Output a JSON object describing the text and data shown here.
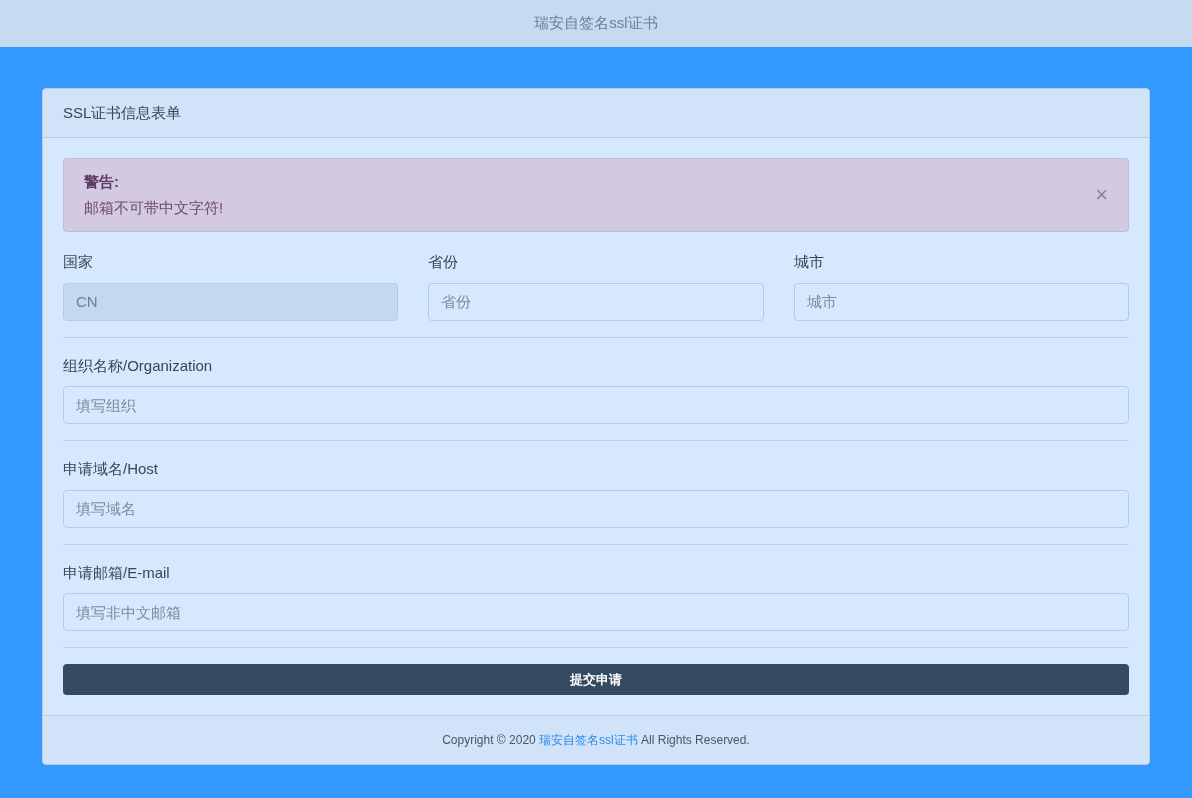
{
  "top_bar": {
    "title": "瑞安自签名ssl证书"
  },
  "card": {
    "header": "SSL证书信息表单"
  },
  "alert": {
    "title": "警告:",
    "message": "邮箱不可带中文字符!",
    "close": "×"
  },
  "location_fields": [
    {
      "label": "国家",
      "value": "CN",
      "disabled": true
    },
    {
      "label": "省份",
      "placeholder": "省份",
      "disabled": false
    },
    {
      "label": "城市",
      "placeholder": "城市",
      "disabled": false
    }
  ],
  "fields": [
    {
      "label": "组织名称/Organization",
      "placeholder": "填写组织"
    },
    {
      "label": "申请域名/Host",
      "placeholder": "填写域名"
    },
    {
      "label": "申请邮箱/E-mail",
      "placeholder": "填写非中文邮箱"
    }
  ],
  "submit": "提交申请",
  "footer": {
    "before": "Copyright © 2020",
    "link": "瑞安自签名ssl证书",
    "after": "All Rights Reserved."
  }
}
